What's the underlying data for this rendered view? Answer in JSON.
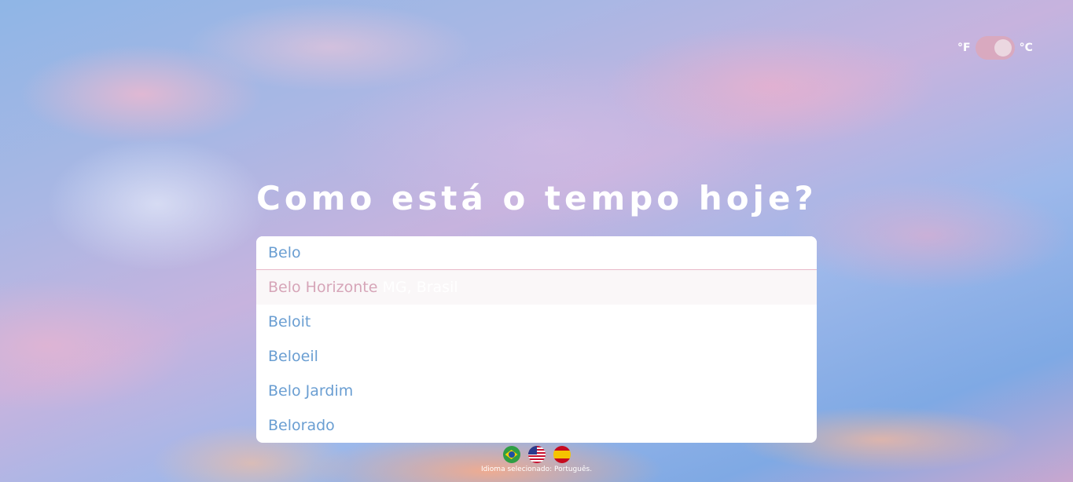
{
  "unit_toggle": {
    "left_label": "°F",
    "right_label": "°C",
    "selected": "°C"
  },
  "title": "Como está o tempo hoje?",
  "search": {
    "value": "Belo",
    "suggestions": [
      {
        "name": "Belo Horizonte",
        "region": "MG, Brasil",
        "highlighted": true
      },
      {
        "name": "Beloit",
        "region": ""
      },
      {
        "name": "Beloeil",
        "region": ""
      },
      {
        "name": "Belo Jardim",
        "region": ""
      },
      {
        "name": "Belorado",
        "region": ""
      }
    ]
  },
  "languages": {
    "flags": [
      "brazil-flag-icon",
      "usa-flag-icon",
      "spain-flag-icon"
    ],
    "selected_text": "Idioma selecionado: Português."
  },
  "colors": {
    "accent_pink": "#d6a5b8",
    "text_blue": "#6a9ed2"
  }
}
